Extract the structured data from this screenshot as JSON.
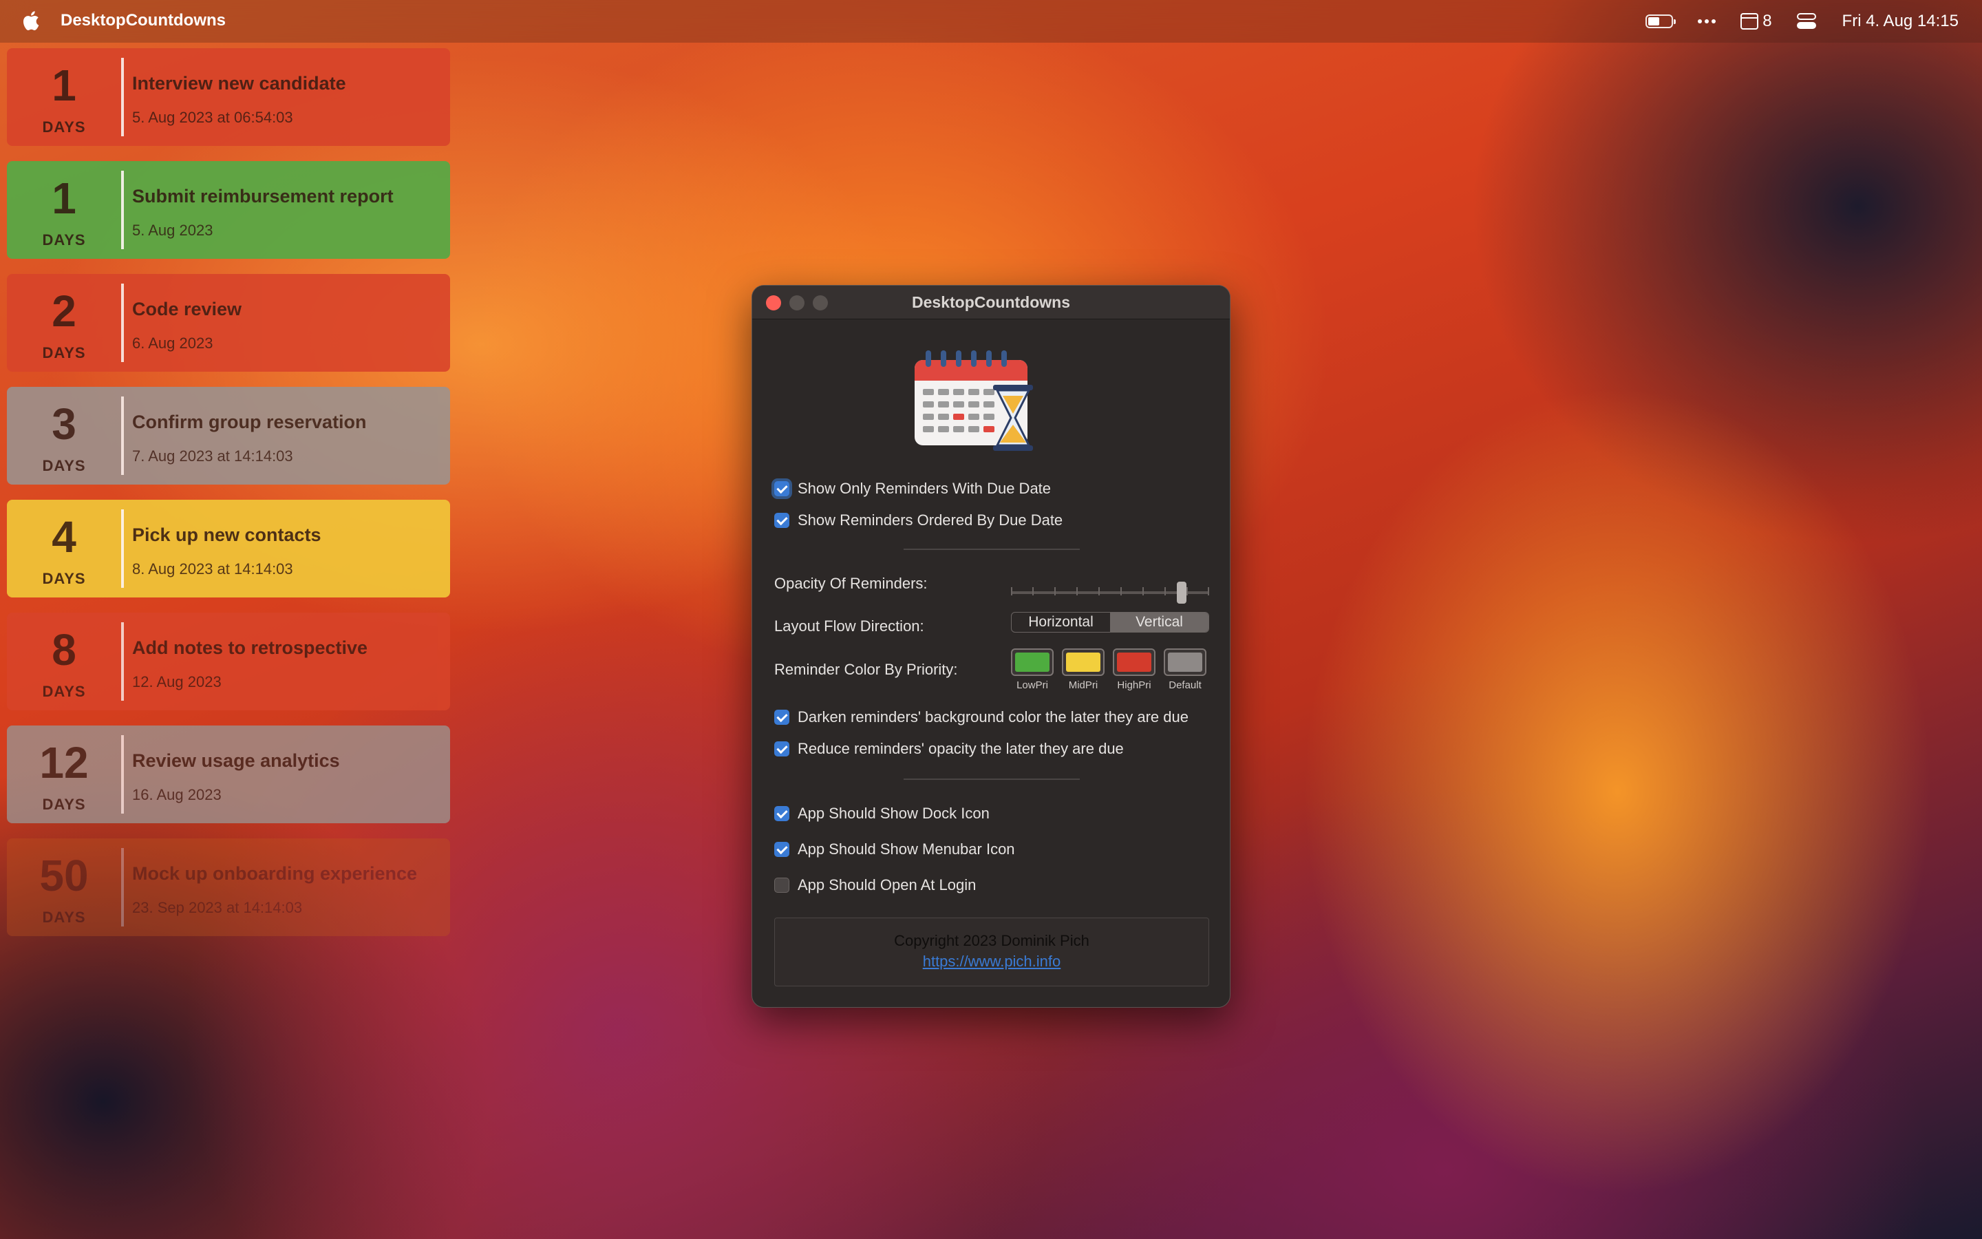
{
  "menubar": {
    "app_name": "DesktopCountdowns",
    "calendar_count": "8",
    "clock": "Fri 4. Aug  14:15"
  },
  "cards": [
    {
      "days": "1",
      "unit": "DAYS",
      "title": "Interview new candidate",
      "date": "5. Aug 2023 at 06:54:03",
      "color": "#d8442a",
      "opacity": 0.92
    },
    {
      "days": "1",
      "unit": "DAYS",
      "title": "Submit reimbursement report",
      "date": "5. Aug 2023",
      "color": "#5aa845",
      "opacity": 0.95
    },
    {
      "days": "2",
      "unit": "DAYS",
      "title": "Code review",
      "date": "6. Aug 2023",
      "color": "#d8442a",
      "opacity": 0.9
    },
    {
      "days": "3",
      "unit": "DAYS",
      "title": "Confirm group reservation",
      "date": "7. Aug 2023 at 14:14:03",
      "color": "#9b9390",
      "opacity": 0.88
    },
    {
      "days": "4",
      "unit": "DAYS",
      "title": "Pick up new contacts",
      "date": "8. Aug 2023 at 14:14:03",
      "color": "#f0c238",
      "opacity": 0.95
    },
    {
      "days": "8",
      "unit": "DAYS",
      "title": "Add notes to retrospective",
      "date": "12. Aug 2023",
      "color": "#d8442a",
      "opacity": 0.82
    },
    {
      "days": "12",
      "unit": "DAYS",
      "title": "Review usage analytics",
      "date": "16. Aug 2023",
      "color": "#9b9390",
      "opacity": 0.78
    },
    {
      "days": "50",
      "unit": "DAYS",
      "title": "Mock up onboarding experience",
      "date": "23. Sep 2023 at 14:14:03",
      "color": "#c0561e",
      "opacity": 0.35
    }
  ],
  "window": {
    "title": "DesktopCountdowns",
    "show_only_due": {
      "label": "Show Only Reminders With Due Date",
      "checked": true
    },
    "ordered_by_due": {
      "label": "Show Reminders Ordered By Due Date",
      "checked": true
    },
    "opacity": {
      "label": "Opacity Of Reminders:",
      "value": 0.88
    },
    "layout": {
      "label": "Layout Flow Direction:",
      "options": [
        "Horizontal",
        "Vertical"
      ],
      "selected": "Vertical"
    },
    "priority": {
      "label": "Reminder Color By Priority:",
      "swatches": [
        {
          "caption": "LowPri",
          "color": "#4eac3f"
        },
        {
          "caption": "MidPri",
          "color": "#f2cf3d"
        },
        {
          "caption": "HighPri",
          "color": "#d33b2c"
        },
        {
          "caption": "Default",
          "color": "#8e8987"
        }
      ]
    },
    "darken": {
      "label": "Darken reminders' background color the later they are due",
      "checked": true
    },
    "reduce": {
      "label": "Reduce reminders' opacity the later they are due",
      "checked": true
    },
    "dock_icon": {
      "label": "App Should Show Dock Icon",
      "checked": true
    },
    "menubar_icon": {
      "label": "App Should Show Menubar Icon",
      "checked": true
    },
    "open_login": {
      "label": "App Should Open At Login",
      "checked": false
    },
    "footer": {
      "copyright": "Copyright 2023 Dominik Pich",
      "link": "https://www.pich.info"
    }
  }
}
